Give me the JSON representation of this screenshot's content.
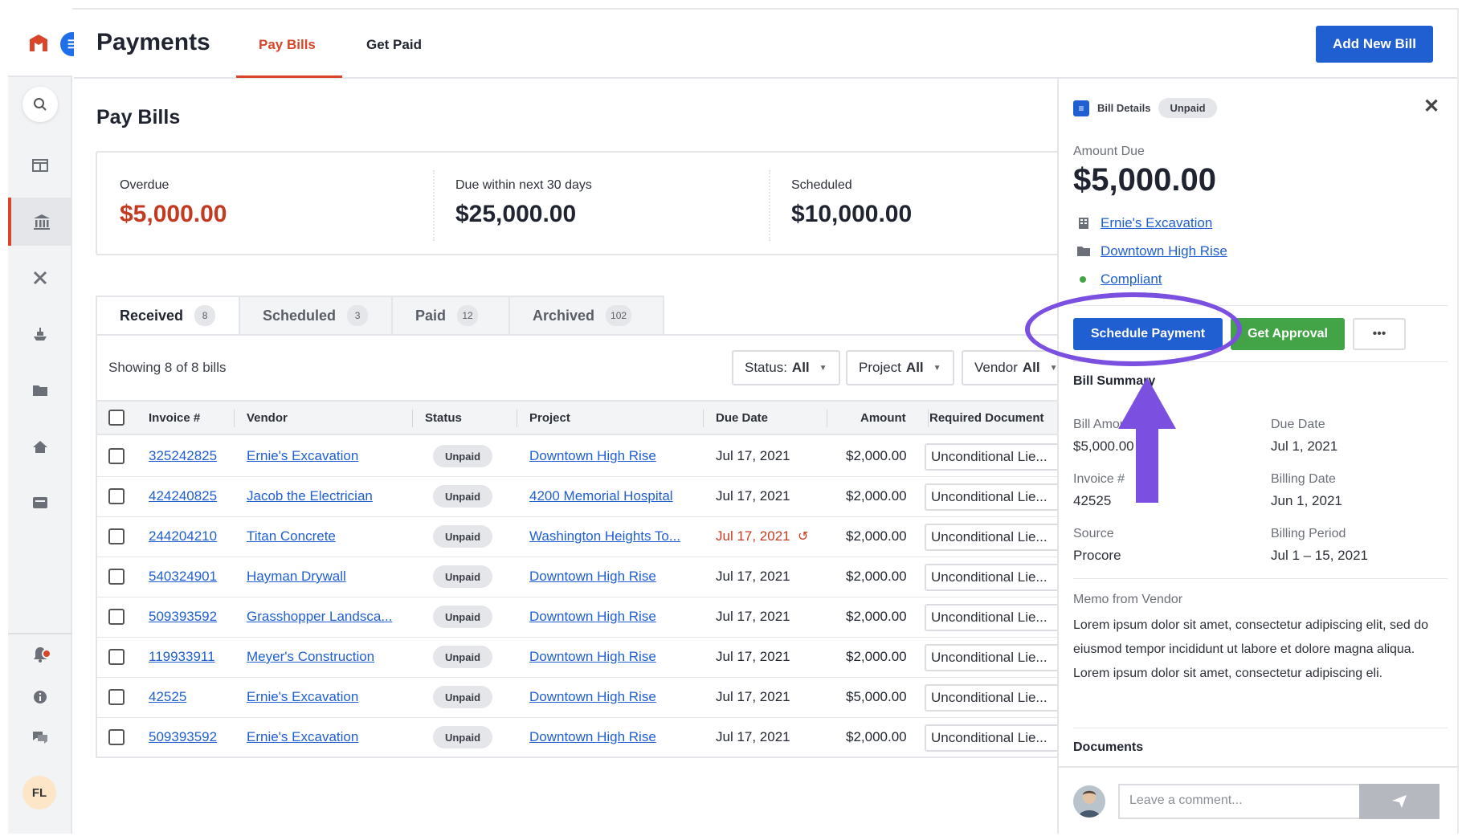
{
  "app": {
    "title": "Payments",
    "logo_letter": "☰"
  },
  "header": {
    "tabs": [
      {
        "label": "Pay Bills",
        "active": true
      },
      {
        "label": "Get Paid",
        "active": false
      }
    ],
    "add_button": "Add New Bill"
  },
  "sidebar": {
    "icons": [
      "search-icon",
      "layout-icon",
      "bank-icon",
      "tools-icon",
      "ship-icon",
      "folder-icon",
      "home-icon",
      "inbox-icon",
      "bell-icon",
      "info-icon",
      "chat-icon"
    ],
    "avatar_initials": "FL"
  },
  "main": {
    "title": "Pay Bills",
    "stats": [
      {
        "label": "Overdue",
        "value": "$5,000.00",
        "color": "#c43a20"
      },
      {
        "label": "Due within next 30 days",
        "value": "$25,000.00",
        "color": "#1f2430"
      },
      {
        "label": "Scheduled",
        "value": "$10,000.00",
        "color": "#1f2430"
      }
    ],
    "tabs": [
      {
        "label": "Received",
        "count": "8"
      },
      {
        "label": "Scheduled",
        "count": "3"
      },
      {
        "label": "Paid",
        "count": "12"
      },
      {
        "label": "Archived",
        "count": "102"
      }
    ],
    "showing_text": "Showing 8 of 8 bills",
    "filters": [
      {
        "label": "Status:",
        "value": "All"
      },
      {
        "label": "Project",
        "value": "All"
      },
      {
        "label": "Vendor",
        "value": "All"
      }
    ],
    "columns": [
      "Invoice #",
      "Vendor",
      "Status",
      "Project",
      "Due Date",
      "Amount",
      "Required Document"
    ],
    "rows": [
      {
        "invoice": "325242825",
        "vendor": "Ernie's Excavation",
        "status": "Unpaid",
        "project": "Downtown High Rise",
        "due": "Jul 17, 2021",
        "amount": "$2,000.00",
        "doc": "Unconditional Lie...",
        "overdue": false
      },
      {
        "invoice": "424240825",
        "vendor": "Jacob the Electrician",
        "status": "Unpaid",
        "project": "4200 Memorial Hospital",
        "due": "Jul 17, 2021",
        "amount": "$2,000.00",
        "doc": "Unconditional Lie...",
        "overdue": false
      },
      {
        "invoice": "244204210",
        "vendor": "Titan Concrete",
        "status": "Unpaid",
        "project": "Washington Heights To...",
        "due": "Jul 17, 2021",
        "amount": "$2,000.00",
        "doc": "Unconditional Lie...",
        "overdue": true
      },
      {
        "invoice": "540324901",
        "vendor": "Hayman Drywall",
        "status": "Unpaid",
        "project": "Downtown High Rise",
        "due": "Jul 17, 2021",
        "amount": "$2,000.00",
        "doc": "Unconditional Lie...",
        "overdue": false
      },
      {
        "invoice": "509393592",
        "vendor": "Grasshopper Landsca...",
        "status": "Unpaid",
        "project": "Downtown High Rise",
        "due": "Jul 17, 2021",
        "amount": "$2,000.00",
        "doc": "Unconditional Lie...",
        "overdue": false
      },
      {
        "invoice": "119933911",
        "vendor": "Meyer's Construction",
        "status": "Unpaid",
        "project": "Downtown High Rise",
        "due": "Jul 17, 2021",
        "amount": "$2,000.00",
        "doc": "Unconditional Lie...",
        "overdue": false
      },
      {
        "invoice": "42525",
        "vendor": "Ernie's Excavation",
        "status": "Unpaid",
        "project": "Downtown High Rise",
        "due": "Jul 17, 2021",
        "amount": "$5,000.00",
        "doc": "Unconditional Lie...",
        "overdue": false
      },
      {
        "invoice": "509393592",
        "vendor": "Ernie's Excavation",
        "status": "Unpaid",
        "project": "Downtown High Rise",
        "due": "Jul 17, 2021",
        "amount": "$2,000.00",
        "doc": "Unconditional Lie...",
        "overdue": false
      }
    ]
  },
  "panel": {
    "header_label": "Bill Details",
    "status_pill": "Unpaid",
    "amount_label": "Amount Due",
    "amount": "$5,000.00",
    "vendor_link": "Ernie's Excavation",
    "project_link": "Downtown High Rise",
    "compliance_link": "Compliant",
    "schedule_button": "Schedule Payment",
    "approval_button": "Get Approval",
    "more_button": "•••",
    "summary_title": "Bill Summary",
    "fields": [
      {
        "label": "Bill Amount",
        "value": "$5,000.00"
      },
      {
        "label": "Due Date",
        "value": "Jul 1, 2021"
      },
      {
        "label": "Invoice #",
        "value": "42525"
      },
      {
        "label": "Billing Date",
        "value": "Jun 1, 2021"
      },
      {
        "label": "Source",
        "value": "Procore"
      },
      {
        "label": "Billing Period",
        "value": "Jul 1 – 15, 2021"
      }
    ],
    "memo_label": "Memo from Vendor",
    "memo": "Lorem ipsum dolor sit amet, consectetur adipiscing elit, sed do eiusmod tempor incididunt ut labore et dolore magna aliqua. Lorem ipsum dolor sit amet, consectetur adipiscing eli.",
    "documents_title": "Documents",
    "comment_placeholder": "Leave a comment..."
  },
  "colors": {
    "brand_red": "#d8452a",
    "primary_blue": "#1f5fd1",
    "approve_green": "#43a347",
    "annotation_purple": "#7b4fe0"
  }
}
